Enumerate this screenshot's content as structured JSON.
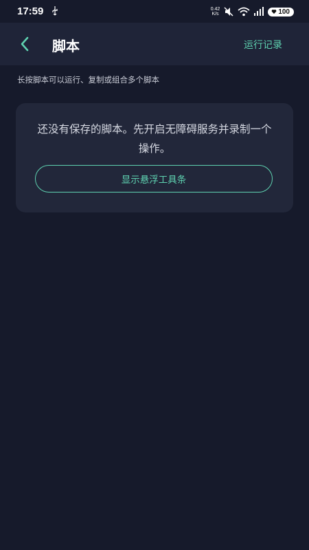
{
  "status_bar": {
    "time": "17:59",
    "net_speed_value": "0.42",
    "net_speed_unit": "K/s",
    "battery": "100",
    "icons": [
      "usb-icon",
      "mute-icon",
      "wifi-icon",
      "signal-icon",
      "battery-icon"
    ]
  },
  "header": {
    "title": "脚本",
    "back_icon": "chevron-left-icon",
    "run_log_label": "运行记录"
  },
  "hint": "长按脚本可以运行、复制或组合多个脚本",
  "empty_state": {
    "message": "还没有保存的脚本。先开启无障碍服务并录制一个操作。",
    "button_label": "显示悬浮工具条"
  },
  "colors": {
    "background": "#161a2b",
    "app_bar": "#1f2438",
    "card": "#22273a",
    "accent": "#5fd3b1"
  }
}
